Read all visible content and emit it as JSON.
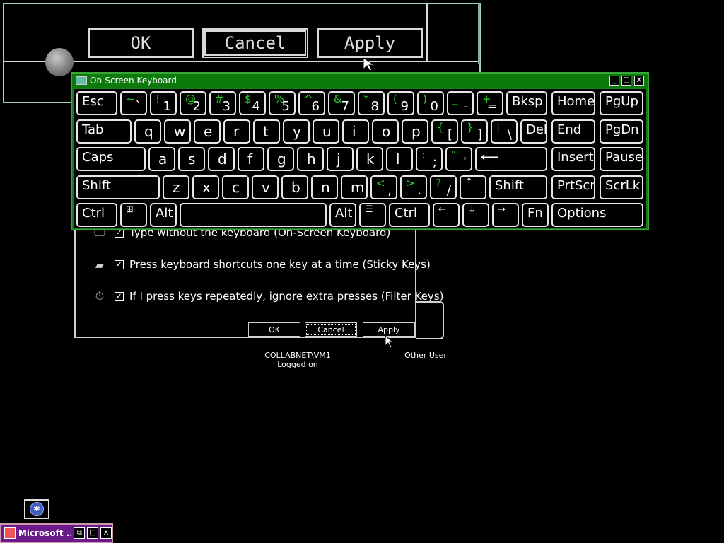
{
  "magnifier": {
    "ok_label": "OK",
    "cancel_label": "Cancel",
    "apply_label": "Apply"
  },
  "ease_dialog": {
    "options": [
      {
        "label": "Type without the keyboard (On-Screen Keyboard)",
        "checked": true,
        "icon": "monitor-keyboard-icon"
      },
      {
        "label": "Press keyboard shortcuts one key at a time (Sticky Keys)",
        "checked": true,
        "icon": "sticky-key-icon"
      },
      {
        "label": "If I press keys repeatedly, ignore extra presses (Filter Keys)",
        "checked": true,
        "icon": "stopwatch-icon"
      }
    ],
    "ok_label": "OK",
    "cancel_label": "Cancel",
    "apply_label": "Apply"
  },
  "users": {
    "current": {
      "name": "COLLABNET\\VM1",
      "status": "Logged on"
    },
    "other": {
      "name": "Other User"
    }
  },
  "osk": {
    "title": "On-Screen Keyboard",
    "minimize": "_",
    "maximize": "□",
    "close": "X",
    "row1": [
      {
        "lbl": "Esc"
      },
      {
        "hi": "~",
        "lo": "`"
      },
      {
        "hi": "!",
        "lo": "1"
      },
      {
        "hi": "@",
        "lo": "2"
      },
      {
        "hi": "#",
        "lo": "3"
      },
      {
        "hi": "$",
        "lo": "4"
      },
      {
        "hi": "%",
        "lo": "5"
      },
      {
        "hi": "^",
        "lo": "6"
      },
      {
        "hi": "&",
        "lo": "7"
      },
      {
        "hi": "*",
        "lo": "8"
      },
      {
        "hi": "(",
        "lo": "9"
      },
      {
        "hi": ")",
        "lo": "0"
      },
      {
        "hi": "_",
        "lo": "-"
      },
      {
        "hi": "+",
        "lo": "="
      },
      {
        "lbl": "Bksp"
      },
      {
        "lbl": "Home"
      },
      {
        "lbl": "PgUp"
      }
    ],
    "row2": [
      {
        "lbl": "Tab"
      },
      {
        "lbl": "q"
      },
      {
        "lbl": "w"
      },
      {
        "lbl": "e"
      },
      {
        "lbl": "r"
      },
      {
        "lbl": "t"
      },
      {
        "lbl": "y"
      },
      {
        "lbl": "u"
      },
      {
        "lbl": "i"
      },
      {
        "lbl": "o"
      },
      {
        "lbl": "p"
      },
      {
        "hi": "{",
        "lo": "["
      },
      {
        "hi": "}",
        "lo": "]"
      },
      {
        "hi": "|",
        "lo": "\\"
      },
      {
        "lbl": "Del"
      },
      {
        "lbl": "End"
      },
      {
        "lbl": "PgDn"
      }
    ],
    "row3": [
      {
        "lbl": "Caps"
      },
      {
        "lbl": "a"
      },
      {
        "lbl": "s"
      },
      {
        "lbl": "d"
      },
      {
        "lbl": "f"
      },
      {
        "lbl": "g"
      },
      {
        "lbl": "h"
      },
      {
        "lbl": "j"
      },
      {
        "lbl": "k"
      },
      {
        "lbl": "l"
      },
      {
        "hi": ":",
        "lo": ";"
      },
      {
        "hi": "\"",
        "lo": "'"
      },
      {
        "lbl": "⟵"
      },
      {
        "lbl": "Insert"
      },
      {
        "lbl": "Pause"
      }
    ],
    "row4": [
      {
        "lbl": "Shift"
      },
      {
        "lbl": "z"
      },
      {
        "lbl": "x"
      },
      {
        "lbl": "c"
      },
      {
        "lbl": "v"
      },
      {
        "lbl": "b"
      },
      {
        "lbl": "n"
      },
      {
        "lbl": "m"
      },
      {
        "hi": "<",
        "lo": ","
      },
      {
        "hi": ">",
        "lo": "."
      },
      {
        "hi": "?",
        "lo": "/"
      },
      {
        "lbl": "↑"
      },
      {
        "lbl": "Shift"
      },
      {
        "lbl": "PrtScn"
      },
      {
        "lbl": "ScrLk"
      }
    ],
    "row5": [
      {
        "lbl": "Ctrl"
      },
      {
        "lbl": "⊞"
      },
      {
        "lbl": "Alt"
      },
      {
        "lbl": ""
      },
      {
        "lbl": "Alt"
      },
      {
        "lbl": "☰"
      },
      {
        "lbl": "Ctrl"
      },
      {
        "lbl": "←"
      },
      {
        "lbl": "↓"
      },
      {
        "lbl": "→"
      },
      {
        "lbl": "Fn"
      },
      {
        "lbl": "Options"
      }
    ]
  },
  "taskbar": {
    "task_title": "Microsoft ...",
    "restore": "⧉",
    "maximize": "□",
    "close": "X"
  }
}
